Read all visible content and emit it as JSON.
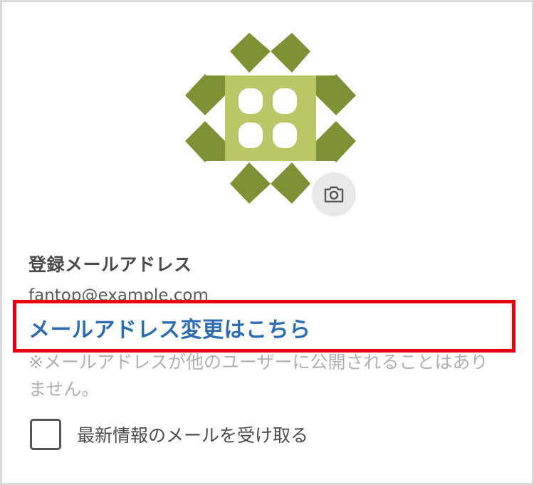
{
  "profile": {
    "avatar": {
      "icon": "identicon-avatar",
      "colors": {
        "dark": "#7f9135",
        "light": "#bac766"
      }
    },
    "camera_button": {
      "icon": "camera-icon"
    }
  },
  "account": {
    "email_label": "登録メールアドレス",
    "email_value": "fantop@example.com",
    "change_email_link": "メールアドレス変更はこちら",
    "privacy_note": "※メールアドレスが他のユーザーに公開されることはありません。"
  },
  "newsletter": {
    "label": "最新情報のメールを受け取る",
    "checked": false
  },
  "colors": {
    "link": "#2d6db5",
    "highlight": "#e60012",
    "text": "#4a4a4a",
    "muted": "#b0b0b0"
  }
}
